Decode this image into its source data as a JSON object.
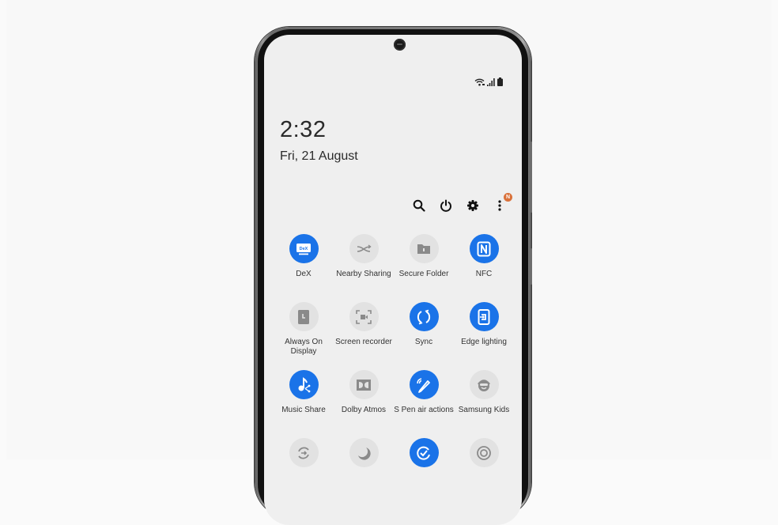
{
  "status_bar": {
    "icons": [
      "wifi-icon",
      "signal-icon",
      "battery-icon"
    ]
  },
  "lock": {
    "time": "2:32",
    "date": "Fri, 21 August"
  },
  "toolbar": {
    "buttons": [
      {
        "name": "search-button",
        "icon": "search-icon"
      },
      {
        "name": "power-button",
        "icon": "power-icon"
      },
      {
        "name": "settings-button",
        "icon": "gear-icon"
      },
      {
        "name": "more-options-button",
        "icon": "more-vertical-icon",
        "badge": "N"
      }
    ],
    "badge_color": "#d9713a"
  },
  "colors": {
    "tile_on": "#1a73e8",
    "tile_off": "#e2e2e2",
    "screen_bg": "#efefef"
  },
  "tiles": [
    {
      "label": "DeX",
      "icon": "dex-icon",
      "state": "on"
    },
    {
      "label": "Nearby Sharing",
      "icon": "nearby-sharing-icon",
      "state": "off"
    },
    {
      "label": "Secure Folder",
      "icon": "secure-folder-icon",
      "state": "off"
    },
    {
      "label": "NFC",
      "icon": "nfc-icon",
      "state": "on"
    },
    {
      "label": "Always On Display",
      "icon": "always-on-display-icon",
      "state": "off"
    },
    {
      "label": "Screen recorder",
      "icon": "screen-recorder-icon",
      "state": "off"
    },
    {
      "label": "Sync",
      "icon": "sync-icon",
      "state": "on"
    },
    {
      "label": "Edge lighting",
      "icon": "edge-lighting-icon",
      "state": "on"
    },
    {
      "label": "Music Share",
      "icon": "music-share-icon",
      "state": "on"
    },
    {
      "label": "Dolby Atmos",
      "icon": "dolby-atmos-icon",
      "state": "off"
    },
    {
      "label": "S Pen air actions",
      "icon": "s-pen-icon",
      "state": "on"
    },
    {
      "label": "Samsung Kids",
      "icon": "samsung-kids-icon",
      "state": "off"
    },
    {
      "label": "",
      "icon": "smart-view-icon",
      "state": "off"
    },
    {
      "label": "",
      "icon": "night-mode-icon",
      "state": "off"
    },
    {
      "label": "",
      "icon": "routines-icon",
      "state": "on"
    },
    {
      "label": "",
      "icon": "focus-mode-icon",
      "state": "off"
    }
  ]
}
